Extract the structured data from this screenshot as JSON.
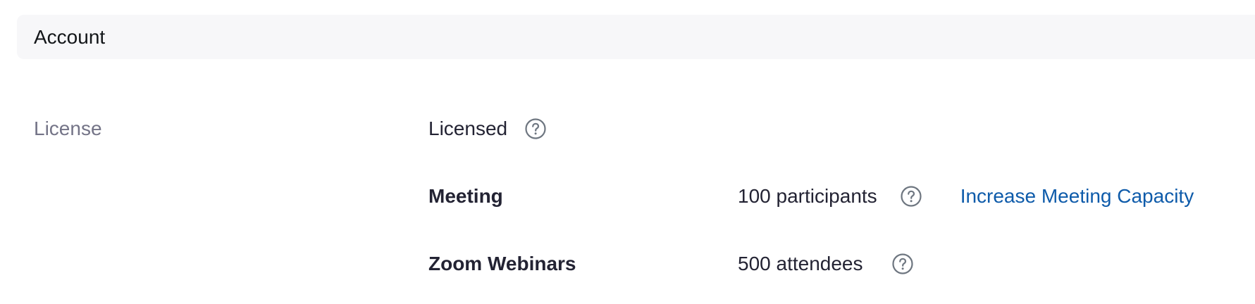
{
  "section": {
    "title": "Account"
  },
  "license": {
    "label": "License",
    "value": "Licensed",
    "help_icon": "question-circle-icon"
  },
  "meeting": {
    "label": "Meeting",
    "value": "100 participants",
    "help_icon": "question-circle-icon",
    "action_link": "Increase Meeting Capacity"
  },
  "webinars": {
    "label": "Zoom Webinars",
    "value": "500 attendees",
    "help_icon": "question-circle-icon"
  },
  "colors": {
    "header_bg": "#f7f7f9",
    "label_gray": "#747487",
    "text_dark": "#232333",
    "link_blue": "#0e5baa",
    "icon_gray": "#6e7680"
  }
}
